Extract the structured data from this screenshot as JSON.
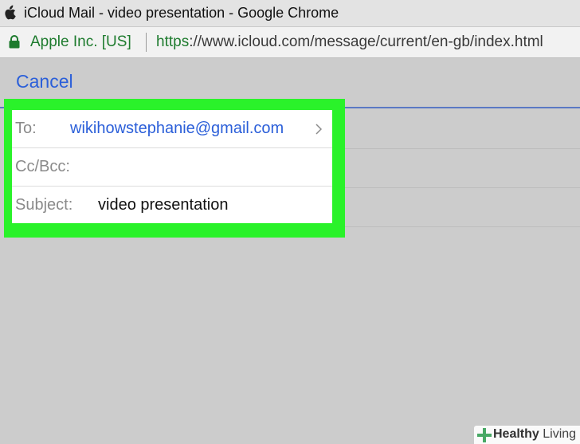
{
  "window": {
    "title": "iCloud Mail - video presentation - Google Chrome"
  },
  "addressbar": {
    "site_identity": "Apple Inc. [US]",
    "url_scheme": "https",
    "url_rest": "://www.icloud.com/message/current/en-gb/index.html"
  },
  "compose": {
    "cancel_label": "Cancel",
    "to_label": "To:",
    "to_value": "wikihowstephanie@gmail.com",
    "cc_label": "Cc/Bcc:",
    "cc_value": "",
    "subject_label": "Subject:",
    "subject_value": "video presentation"
  },
  "watermark": {
    "brand": "Healthy",
    "brand_suffix": " Living"
  },
  "colors": {
    "highlight": "#2af22a",
    "link_blue": "#2b5fd9",
    "secure_green": "#1e7b2e",
    "background": "#cccccc"
  },
  "icons": [
    "apple-icon",
    "lock-icon",
    "chevron-right-icon",
    "healthy-living-logo-icon"
  ]
}
